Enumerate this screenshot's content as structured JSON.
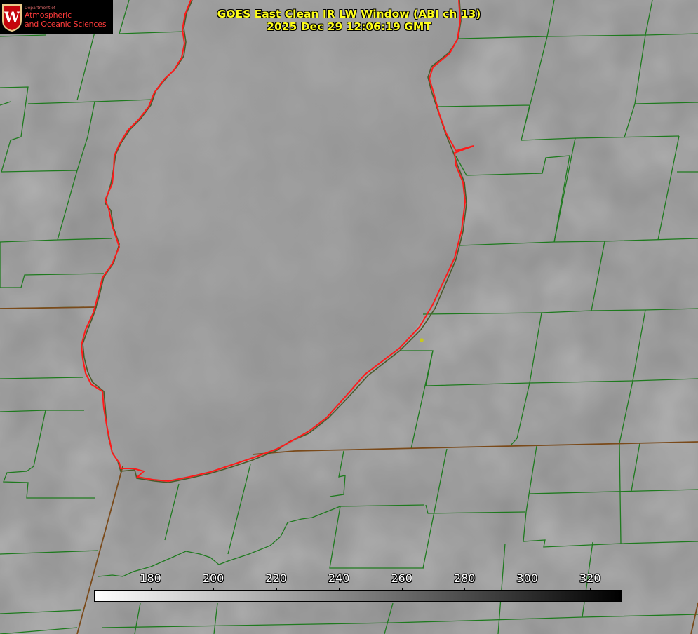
{
  "title": {
    "line1": "GOES East Clean IR LW Window (ABI ch 13)",
    "line2": "2025 Dec 29 12:06:19 GMT"
  },
  "logo": {
    "department": "Department of",
    "line1": "Atmospheric",
    "line2": "and Oceanic Sciences",
    "seal_letter": "W"
  },
  "colorbar": {
    "min": 162,
    "max": 330,
    "ticks": [
      "180",
      "200",
      "220",
      "240",
      "260",
      "280",
      "300",
      "320"
    ],
    "tick_values": [
      180,
      200,
      220,
      240,
      260,
      280,
      300,
      320
    ],
    "color_low": "#ffffff",
    "color_high": "#000000"
  },
  "colors": {
    "county_lines": "#1e7a1e",
    "lake_shoreline": "#ff1a1a",
    "state_border": "#7a4a1a",
    "title_text": "#ffff1a",
    "marker": "#c8c81e"
  }
}
